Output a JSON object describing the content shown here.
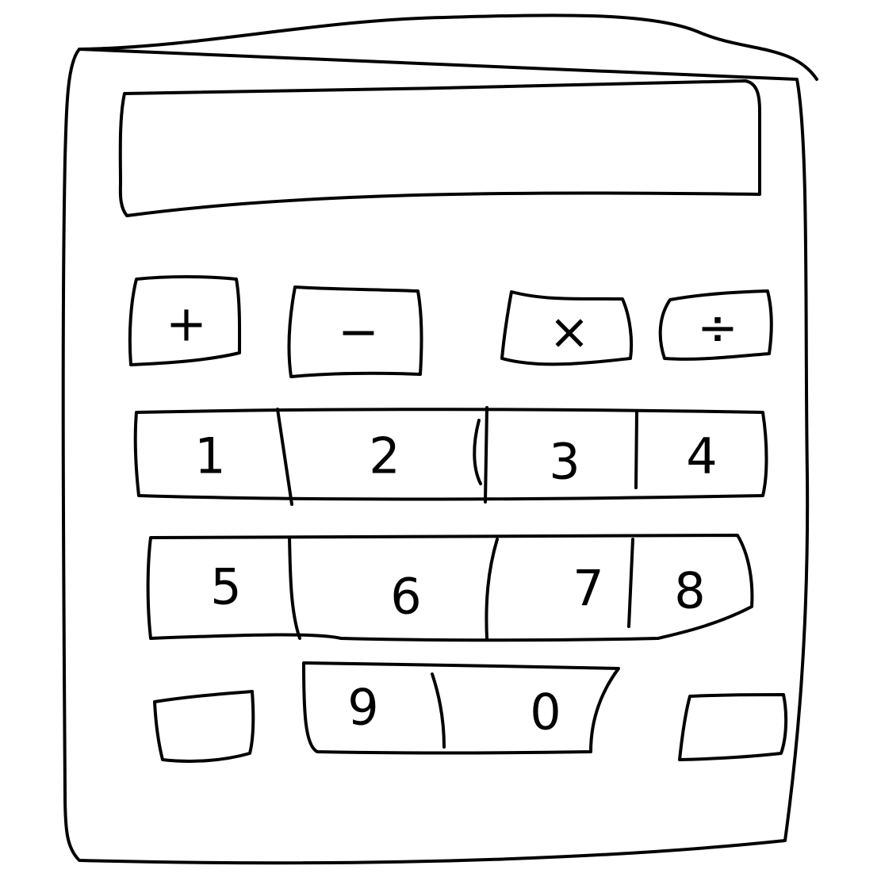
{
  "calculator": {
    "display": {
      "value": ""
    },
    "operators": [
      {
        "id": "plus",
        "symbol": "+"
      },
      {
        "id": "minus",
        "symbol": "−"
      },
      {
        "id": "multiply",
        "symbol": "×"
      },
      {
        "id": "divide",
        "symbol": "÷"
      }
    ],
    "digits_row1": [
      "1",
      "2",
      "3",
      "4"
    ],
    "digits_row2": [
      "5",
      "6",
      "7",
      "8"
    ],
    "digits_row3": [
      "9",
      "0"
    ],
    "blank_keys": [
      "",
      ""
    ]
  },
  "colors": {
    "ink": "#000000",
    "paper": "#ffffff"
  }
}
